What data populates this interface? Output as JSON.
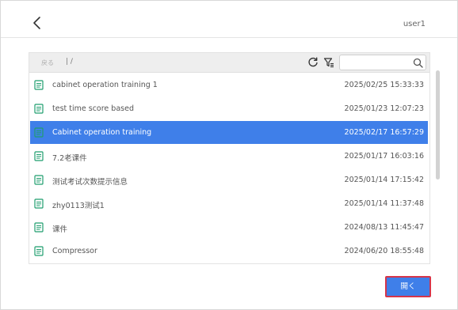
{
  "header": {
    "back_icon": "chevron-left-icon",
    "user": "user1"
  },
  "toolbar": {
    "back_label": "戻る",
    "path": "| /",
    "search_placeholder": "",
    "icons": [
      "refresh-icon",
      "filter-icon",
      "search-icon"
    ]
  },
  "files": [
    {
      "name": "cabinet operation training 1",
      "date": "2025/02/25 15:33:33",
      "selected": false
    },
    {
      "name": "test time score based",
      "date": "2025/01/23 12:07:23",
      "selected": false
    },
    {
      "name": "Cabinet operation training",
      "date": "2025/02/17 16:57:29",
      "selected": true
    },
    {
      "name": "7.2老课件",
      "date": "2025/01/17 16:03:16",
      "selected": false
    },
    {
      "name": "测试考试次数提示信息",
      "date": "2025/01/14 17:15:42",
      "selected": false
    },
    {
      "name": "zhy0113测试1",
      "date": "2025/01/14 11:37:48",
      "selected": false
    },
    {
      "name": "课件",
      "date": "2024/08/13 11:45:47",
      "selected": false
    },
    {
      "name": "Compressor",
      "date": "2024/06/20 18:55:48",
      "selected": false
    }
  ],
  "footer": {
    "open_label": "開く"
  },
  "colors": {
    "accent": "#3f7fe9",
    "icon": "#1f9e6e",
    "highlight_border": "#d6354a"
  }
}
